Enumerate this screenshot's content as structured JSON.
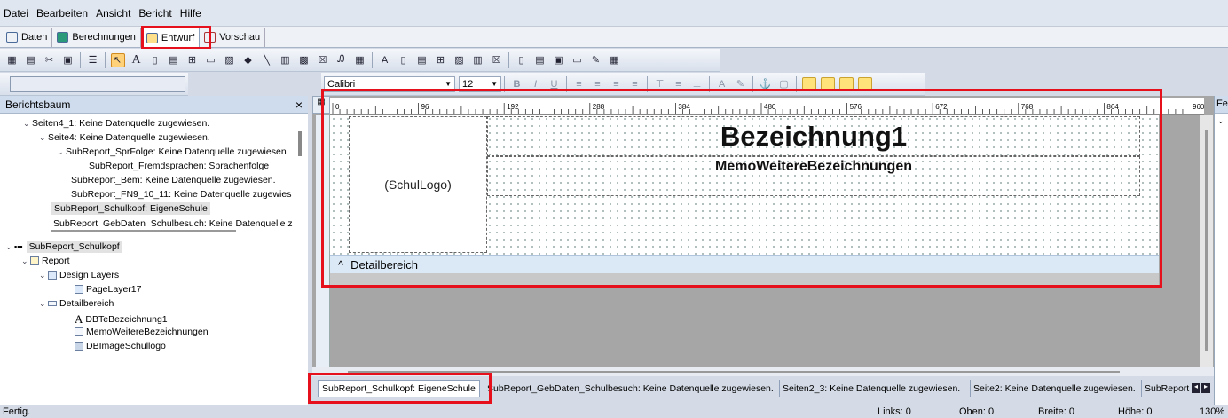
{
  "menu": [
    "Datei",
    "Bearbeiten",
    "Ansicht",
    "Bericht",
    "Hilfe"
  ],
  "view_tabs": [
    {
      "label": "Daten"
    },
    {
      "label": "Berechnungen"
    },
    {
      "label": "Entwurf"
    },
    {
      "label": "Vorschau"
    }
  ],
  "format": {
    "font": "Calibri",
    "size": "12",
    "bold": "B",
    "italic": "I",
    "underline": "U"
  },
  "left_panel": {
    "title": "Berichtsbaum",
    "close": "×",
    "upper_tree": [
      "Seiten4_1: Keine Datenquelle zugewiesen.",
      "Seite4: Keine Datenquelle zugewiesen.",
      "SubReport_SprFolge: Keine Datenquelle zugewiesen",
      "SubReport_Fremdsprachen: Sprachenfolge",
      "SubReport_Bem: Keine Datenquelle zugewiesen.",
      "SubReport_FN9_10_11: Keine Datenquelle zugewies",
      "SubReport_Schulkopf: EigeneSchule",
      "SubReport_GebDaten_Schulbesuch: Keine Datenquelle z"
    ],
    "lower_tree": [
      "SubReport_Schulkopf",
      "Report",
      "Design Layers",
      "PageLayer17",
      "Detailbereich",
      "DBTeBezeichnung1",
      "MemoWeitereBezeichnungen",
      "DBImageSchullogo"
    ]
  },
  "ruler_labels": [
    "0",
    "96",
    "192",
    "288",
    "384",
    "480",
    "576",
    "672",
    "768",
    "864",
    "960"
  ],
  "design": {
    "logo": "(SchulLogo)",
    "title": "Bezeichnung1",
    "memo": "MemoWeitereBezeichnungen",
    "band": "Detailbereich",
    "band_icon": "^"
  },
  "bottom_tabs": [
    "SubReport_Schulkopf: EigeneSchule",
    "SubReport_GebDaten_Schulbesuch: Keine Datenquelle zugewiesen.",
    "Seiten2_3: Keine Datenquelle zugewiesen.",
    "Seite2: Keine Datenquelle zugewiesen.",
    "SubReport"
  ],
  "right_panel_title": "Fe",
  "status": {
    "text": "Fertig.",
    "links": "Links: 0",
    "oben": "Oben: 0",
    "breite": "Breite: 0",
    "hoehe": "Höhe: 0",
    "zoom": "130%"
  },
  "colors": {
    "highlight": "#e5101c",
    "band": "#dbe8f6",
    "workspace": "#a6a6a6"
  }
}
